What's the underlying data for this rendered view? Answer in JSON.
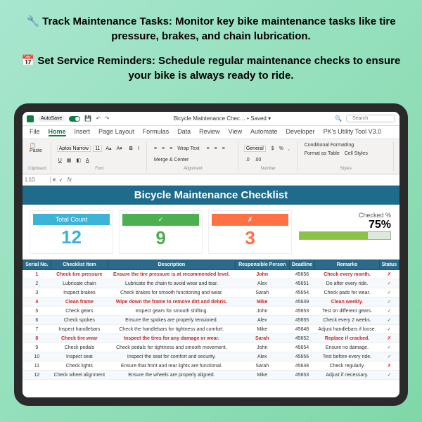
{
  "hero": {
    "line1": "Track Maintenance Tasks: Monitor key bike maintenance tasks like tire pressure, brakes, and chain lubrication.",
    "line2": "Set Service Reminders: Schedule regular maintenance checks to ensure your bike is always ready to ride."
  },
  "titlebar": {
    "autosave": "AutoSave",
    "on": "On",
    "doc": "Bicycle Maintenance Chec… • Saved ▾",
    "search_ph": "Search"
  },
  "tabs": [
    "File",
    "Home",
    "Insert",
    "Page Layout",
    "Formulas",
    "Data",
    "Review",
    "View",
    "Automate",
    "Developer",
    "PK's Utility Tool V3.0"
  ],
  "ribbon": {
    "paste": "Paste",
    "clipboard": "Clipboard",
    "font_name": "Aptos Narrow",
    "font_size": "11",
    "font": "Font",
    "alignment": "Alignment",
    "wrap": "Wrap Text",
    "merge": "Merge & Center",
    "numfmt": "General",
    "number": "Number",
    "cond": "Conditional Formatting",
    "fmtas": "Format as Table",
    "cellsty": "Cell Styles",
    "styles": "Styles"
  },
  "formula": {
    "cell": "L10",
    "fx": "fx"
  },
  "sheet": {
    "title": "Bicycle Maintenance Checklist",
    "total_lbl": "Total Count",
    "total": "12",
    "done_lbl": "✓",
    "done": "9",
    "not_lbl": "✗",
    "not": "3",
    "pct_lbl": "Checked %",
    "pct": "75%",
    "headers": [
      "Serial No.",
      "Checklist Item",
      "Description",
      "Responsible Person",
      "Deadline",
      "Remarks",
      "Status"
    ],
    "rows": [
      {
        "n": "1",
        "item": "Check tire pressure",
        "desc": "Ensure the tire pressure is at recommended level.",
        "who": "John",
        "dl": "45656",
        "rem": "Check every month.",
        "st": "✗",
        "hl": true
      },
      {
        "n": "2",
        "item": "Lubricate chain",
        "desc": "Lubricate the chain to avoid wear and tear.",
        "who": "Alex",
        "dl": "45651",
        "rem": "Do after every ride.",
        "st": "✓",
        "hl": false
      },
      {
        "n": "3",
        "item": "Inspect brakes",
        "desc": "Check brakes for smooth functioning and wear.",
        "who": "Sarah",
        "dl": "45654",
        "rem": "Check pads for wear.",
        "st": "✓",
        "hl": false
      },
      {
        "n": "4",
        "item": "Clean frame",
        "desc": "Wipe down the frame to remove dirt and debris.",
        "who": "Mike",
        "dl": "45649",
        "rem": "Clean weekly.",
        "st": "✓",
        "hl": true
      },
      {
        "n": "5",
        "item": "Check gears",
        "desc": "Inspect gears for smooth shifting.",
        "who": "John",
        "dl": "45653",
        "rem": "Test on different gears.",
        "st": "✓",
        "hl": false
      },
      {
        "n": "6",
        "item": "Check spokes",
        "desc": "Ensure the spokes are properly tensioned.",
        "who": "Alex",
        "dl": "45655",
        "rem": "Check every 2 weeks.",
        "st": "✓",
        "hl": false
      },
      {
        "n": "7",
        "item": "Inspect handlebars",
        "desc": "Check the handlebars for tightness and comfort.",
        "who": "Mike",
        "dl": "45648",
        "rem": "Adjust handlebars if loose.",
        "st": "✓",
        "hl": false
      },
      {
        "n": "8",
        "item": "Check tire wear",
        "desc": "Inspect the tires for any damage or wear.",
        "who": "Sarah",
        "dl": "45652",
        "rem": "Replace if cracked.",
        "st": "✗",
        "hl": true
      },
      {
        "n": "9",
        "item": "Check pedals",
        "desc": "Check pedals for tightness and smooth movement.",
        "who": "John",
        "dl": "45654",
        "rem": "Ensure no damage.",
        "st": "✓",
        "hl": false
      },
      {
        "n": "10",
        "item": "Inspect seat",
        "desc": "Inspect the seat for comfort and security.",
        "who": "Alex",
        "dl": "45656",
        "rem": "Test before every ride.",
        "st": "✓",
        "hl": false
      },
      {
        "n": "11",
        "item": "Check lights",
        "desc": "Ensure that front and rear lights are functional.",
        "who": "Sarah",
        "dl": "45648",
        "rem": "Check regularly.",
        "st": "✗",
        "hl": false
      },
      {
        "n": "12",
        "item": "Check wheel alignment",
        "desc": "Ensure the wheels are properly aligned.",
        "who": "Mike",
        "dl": "45653",
        "rem": "Adjust if necessary.",
        "st": "✓",
        "hl": false
      }
    ]
  }
}
